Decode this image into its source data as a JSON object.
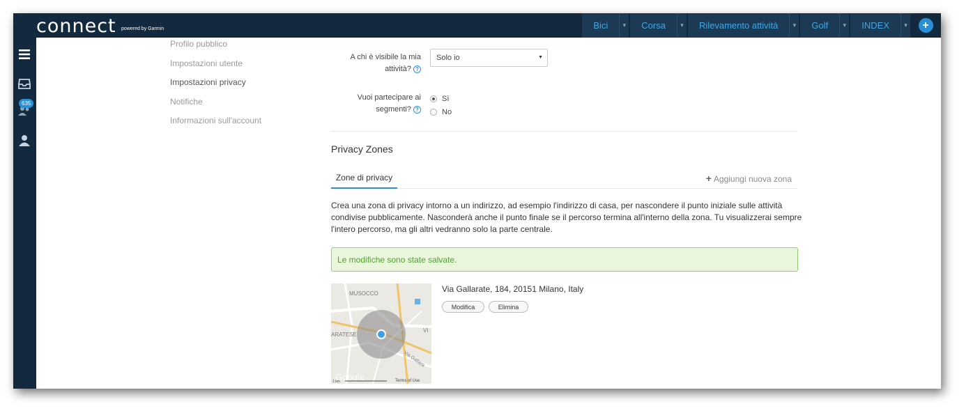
{
  "header": {
    "logo": "connect",
    "logo_sub": "powered by Garmin",
    "nav": [
      {
        "label": "Bici"
      },
      {
        "label": "Corsa"
      },
      {
        "label": "Rilevamento attività"
      },
      {
        "label": "Golf"
      },
      {
        "label": "INDEX"
      }
    ],
    "plus_icon": "+"
  },
  "sidebar": {
    "icons": [
      "menu-icon",
      "inbox-icon",
      "connections-icon",
      "user-icon"
    ],
    "badge": "635"
  },
  "settings_nav": {
    "items": [
      {
        "label": "Profilo pubblico"
      },
      {
        "label": "Impostazioni utente"
      },
      {
        "label": "Impostazioni privacy",
        "active": true
      },
      {
        "label": "Notifiche"
      },
      {
        "label": "Informazioni sull'account"
      }
    ]
  },
  "form": {
    "visibility_label_line1": "A chi è visibile la mia",
    "visibility_label_line2": "attività?",
    "visibility_value": "Solo io",
    "segments_label_line1": "Vuoi partecipare ai",
    "segments_label_line2": "segmenti?",
    "segments_yes": "Sì",
    "segments_no": "No",
    "help_glyph": "?"
  },
  "privacy_zones": {
    "title": "Privacy Zones",
    "tab": "Zone di privacy",
    "add_zone": "Aggiungi nuova zona",
    "description": "Crea una zona di privacy intorno a un indirizzo, ad esempio l'indirizzo di casa, per nascondere il punto iniziale sulle attività condivise pubblicamente. Nasconderà anche il punto finale se il percorso termina all'interno della zona. Tu visualizzerai sempre l'intero percorso, ma gli altri vedranno solo la parte centrale.",
    "success_message": "Le modifiche sono state salvate.",
    "zone": {
      "address": "Via Gallarate, 184, 20151 Milano, Italy",
      "edit_label": "Modifica",
      "delete_label": "Elimina",
      "map_labels": {
        "musocco": "MUSOCCO",
        "aratese": "ARATESE",
        "via_gallarate": "Via Gallara",
        "vi": "VI",
        "google": "Google",
        "scale": "1 km",
        "terms": "Terms of Use"
      }
    }
  },
  "colors": {
    "header_bg": "#13293d",
    "nav_item_bg": "#1d3a54",
    "nav_text": "#3ea9e7",
    "accent": "#2b8fd6",
    "success_bg": "#e9f6db",
    "success_text": "#4da52b"
  }
}
